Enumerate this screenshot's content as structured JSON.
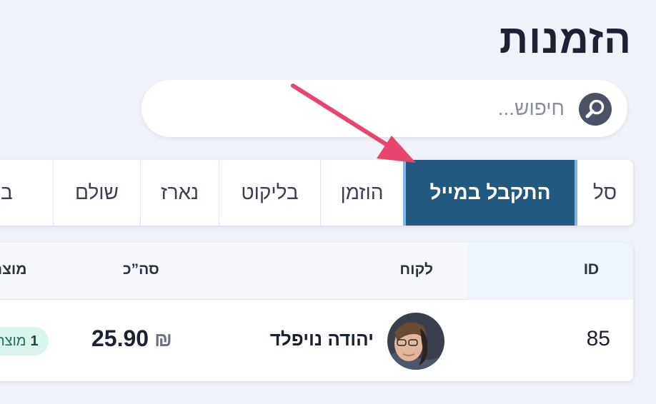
{
  "page": {
    "title": "הזמנות"
  },
  "search": {
    "placeholder": "חיפוש..."
  },
  "tabs": [
    {
      "label": "סל",
      "active": false
    },
    {
      "label": "התקבל במייל",
      "active": true
    },
    {
      "label": "הוזמן",
      "active": false
    },
    {
      "label": "בליקוט",
      "active": false
    },
    {
      "label": "נארז",
      "active": false
    },
    {
      "label": "שולם",
      "active": false
    },
    {
      "label": "במשלוח",
      "active": false
    }
  ],
  "table": {
    "headers": {
      "id": "ID",
      "customer": "לקוח",
      "total": "סה”כ",
      "products": "מוצרים"
    },
    "rows": [
      {
        "id": "85",
        "customer": "יהודה נויפלד",
        "total": "25.90",
        "currency": "₪",
        "products_count": "1",
        "products_label": "מוצר"
      }
    ]
  },
  "colors": {
    "background": "#eff2f8",
    "active_tab": "#23597f",
    "arrow": "#e8456e",
    "badge_bg": "#d9f5ee"
  }
}
